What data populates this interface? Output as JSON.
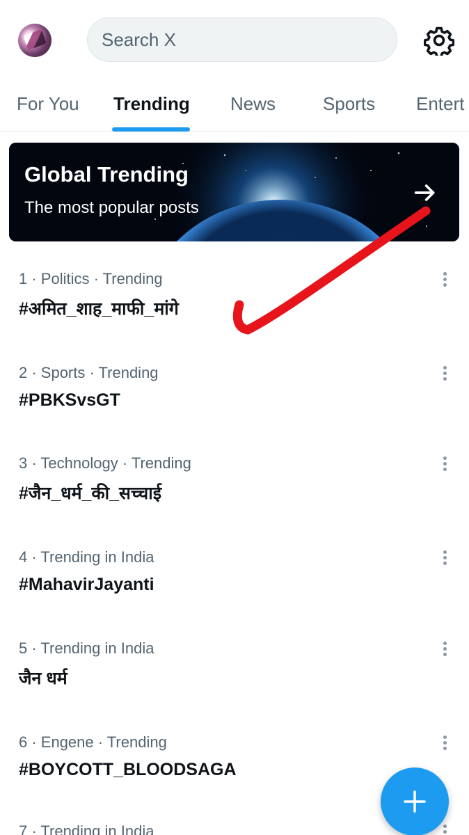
{
  "header": {
    "avatar_icon": "user-avatar",
    "search_placeholder": "Search X",
    "settings_icon": "gear-icon"
  },
  "tabs": [
    {
      "label": "For You"
    },
    {
      "label": "Trending",
      "active": true
    },
    {
      "label": "News"
    },
    {
      "label": "Sports"
    },
    {
      "label": "Entert"
    }
  ],
  "banner": {
    "title": "Global Trending",
    "subtitle": "The most popular posts",
    "arrow_icon": "arrow-right-icon"
  },
  "trends": [
    {
      "meta": "1 · Politics · Trending",
      "topic": "#अमित_शाह_माफी_मांगे"
    },
    {
      "meta": "2 · Sports · Trending",
      "topic": "#PBKSvsGT"
    },
    {
      "meta": "3 · Technology · Trending",
      "topic": "#जैन_धर्म_की_सच्चाई"
    },
    {
      "meta": "4 · Trending in India",
      "topic": "#MahavirJayanti"
    },
    {
      "meta": "5 · Trending in India",
      "topic": "जैन धर्म"
    },
    {
      "meta": "6 · Engene · Trending",
      "topic": "#BOYCOTT_BLOODSAGA"
    },
    {
      "meta": "7 · Trending in India",
      "topic": ""
    }
  ],
  "fab": {
    "icon": "plus-icon"
  },
  "colors": {
    "accent": "#1d9bf0",
    "annotation": "#e8141b",
    "secondary_text": "#536471"
  }
}
